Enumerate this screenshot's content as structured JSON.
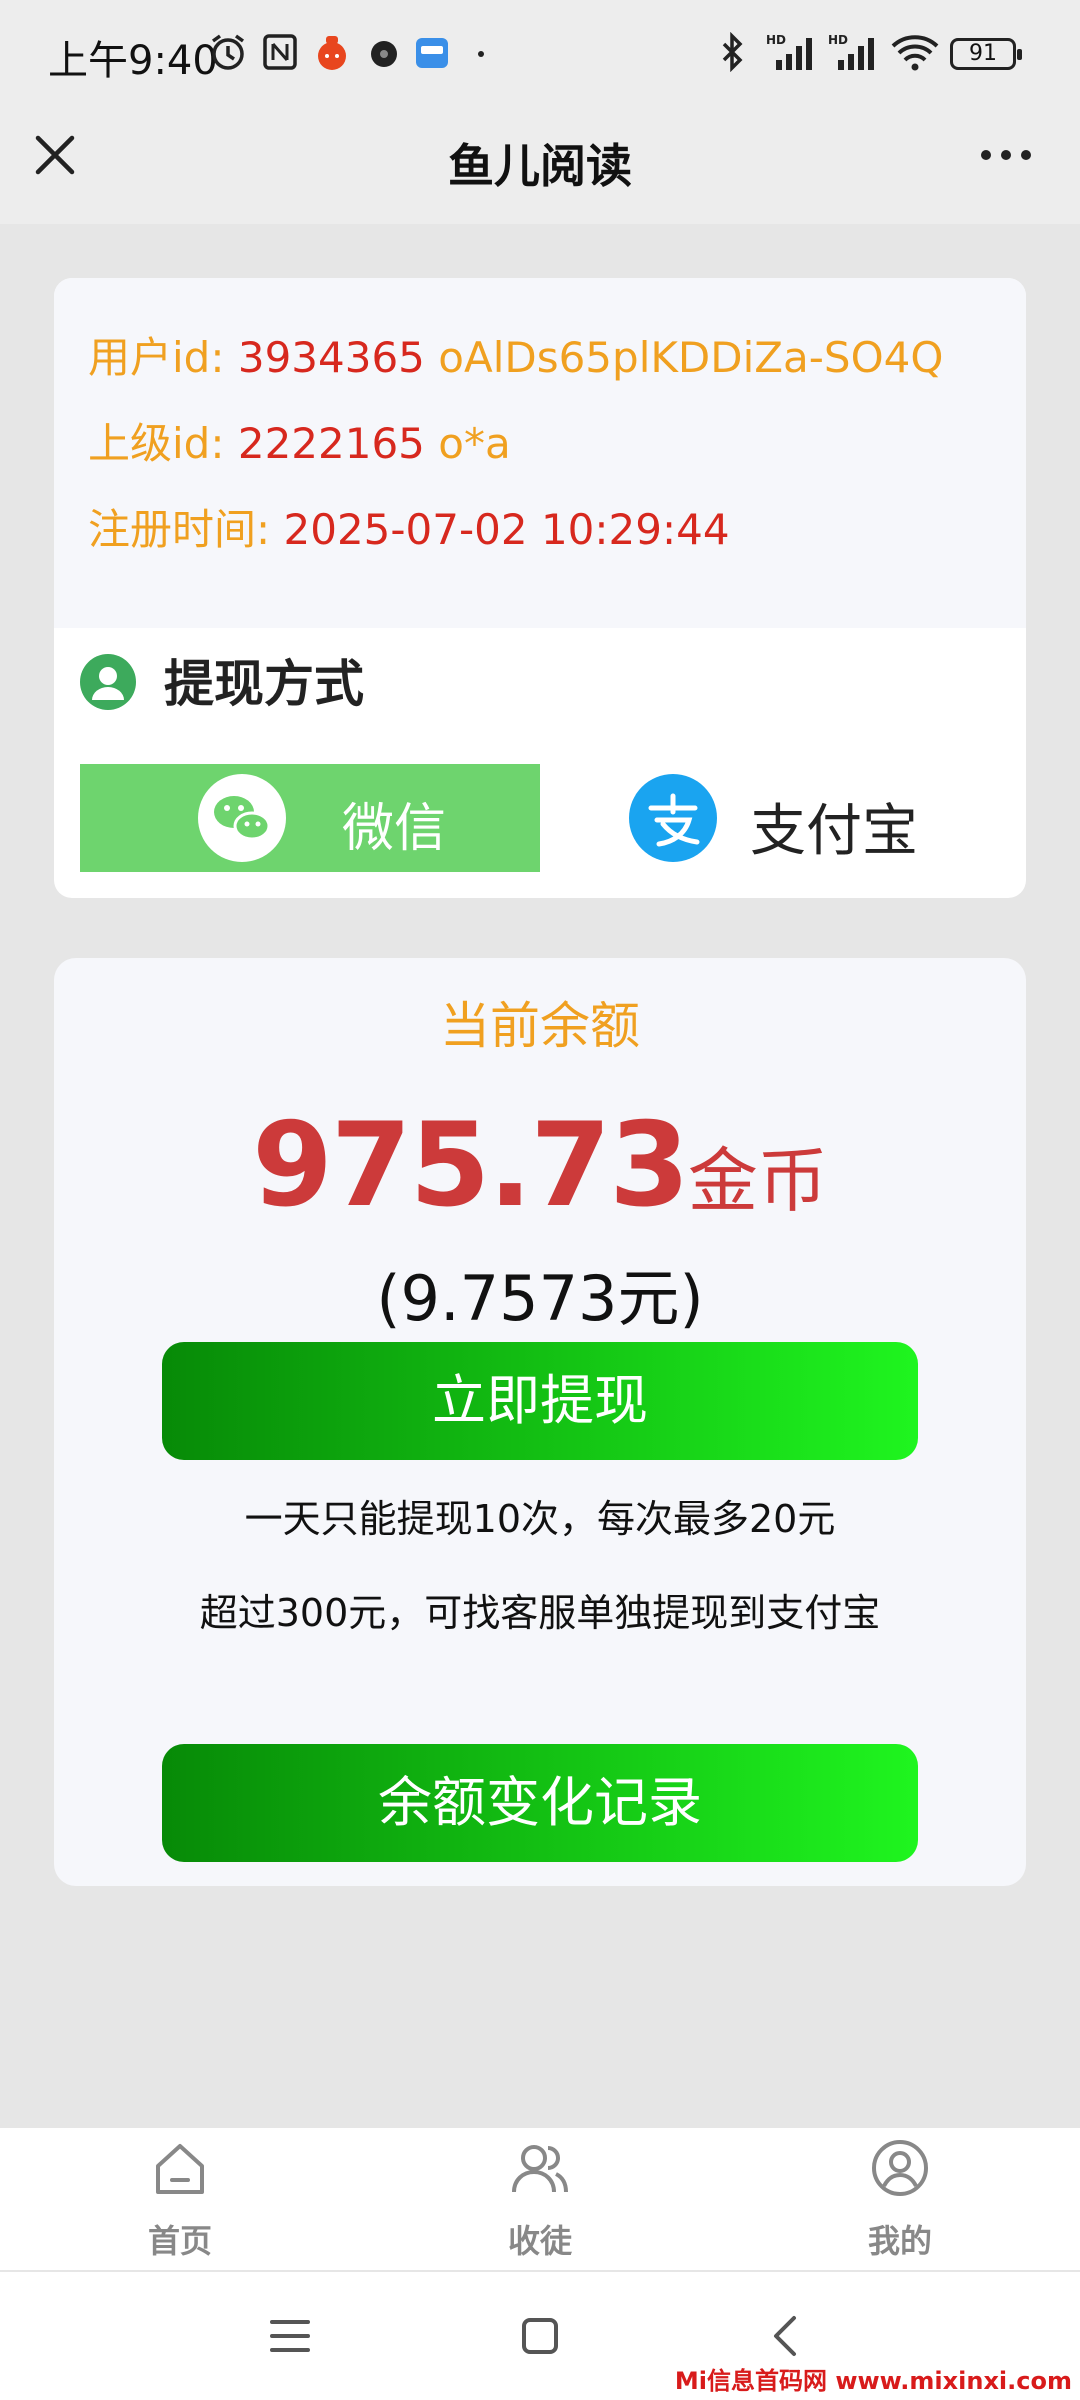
{
  "status_bar": {
    "time": "上午9:40",
    "battery": "91"
  },
  "header": {
    "title": "鱼儿阅读"
  },
  "account": {
    "user_label": "用户id:",
    "user_id": "3934365",
    "user_openid": "oAlDs65plKDDiZa-SO4Q",
    "parent_label": "上级id:",
    "parent_id": "2222165",
    "parent_name": "o*a",
    "register_label": "注册时间:",
    "register_time": "2025-07-02 10:29:44"
  },
  "withdraw_method": {
    "title": "提现方式",
    "options": [
      {
        "label": "微信",
        "selected": true
      },
      {
        "label": "支付宝",
        "selected": false
      }
    ]
  },
  "balance": {
    "title": "当前余额",
    "amount": "975.73",
    "unit": "金币",
    "yuan": "(9.7573元)",
    "withdraw_button": "立即提现",
    "note1": "一天只能提现10次，每次最多20元",
    "note2": "超过300元，可找客服单独提现到支付宝",
    "history_button": "余额变化记录"
  },
  "bottom_nav": [
    {
      "label": "首页",
      "icon": "home-icon"
    },
    {
      "label": "收徒",
      "icon": "users-icon"
    },
    {
      "label": "我的",
      "icon": "profile-icon"
    }
  ],
  "watermark": "Mi信息首码网 www.mixinxi.com",
  "colors": {
    "accent_green": "#1ff51f",
    "label_orange": "#f0a020",
    "value_red": "#d7281e",
    "balance_red": "#cc3a3a",
    "wechat_green": "#6ed46e",
    "alipay_blue": "#1aa4f0"
  }
}
